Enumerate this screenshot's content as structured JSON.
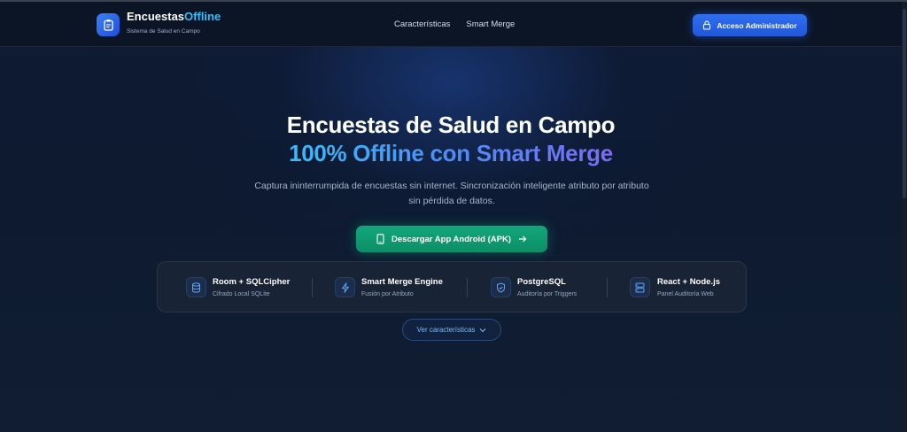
{
  "nav": {
    "brand_main": "Encuestas",
    "brand_accent": "Offline",
    "brand_sub": "Sistema de Salud en Campo",
    "brand_icon": "clipboard-icon",
    "links": [
      "Características",
      "Smart Merge"
    ],
    "admin_label": "Acceso Administrador",
    "admin_icon": "lock-icon"
  },
  "hero": {
    "title_line1": "Encuestas de Salud en Campo",
    "title_line2": "100% Offline con Smart Merge",
    "description": "Captura ininterrumpida de encuestas sin internet. Sincronización inteligente atributo por atributo sin pérdida de datos.",
    "download_label": "Descargar App Android (APK)",
    "download_icon": "phone-icon",
    "download_arrow": "arrow-right-icon"
  },
  "features": [
    {
      "title": "Room + SQLCipher",
      "subtitle": "Cifrado Local SQLite",
      "icon": "database-icon"
    },
    {
      "title": "Smart Merge Engine",
      "subtitle": "Fusión por Atributo",
      "icon": "lightning-icon"
    },
    {
      "title": "PostgreSQL",
      "subtitle": "Auditoría por Triggers",
      "icon": "shield-icon"
    },
    {
      "title": "React + Node.js",
      "subtitle": "Panel Auditoría Web",
      "icon": "server-icon"
    }
  ],
  "more": {
    "label": "Ver características",
    "icon": "chevron-down-icon"
  },
  "colors": {
    "primary": "#2f6ff0",
    "success": "#13a77b",
    "accent": "#38bdf8",
    "background": "#0f1b33"
  }
}
